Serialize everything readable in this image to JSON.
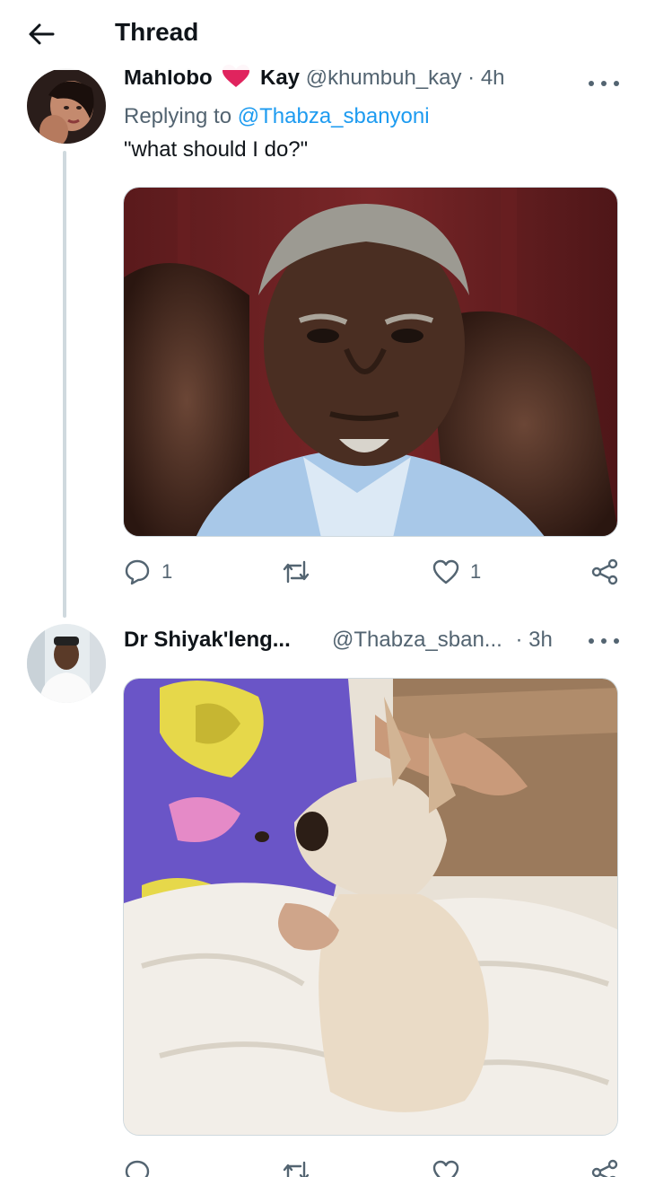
{
  "header": {
    "title": "Thread",
    "back_icon": "arrow-left-icon"
  },
  "tweets": [
    {
      "author_name_first": "Mahlobo",
      "author_name_last": "Kay",
      "handle": "@khumbuh_kay",
      "time": "· 4h",
      "replying_label": "Replying to",
      "replying_to": "@Thabza_sbanyoni",
      "text": "\"what should I do?\"",
      "reply_count": "1",
      "retweet_count": "",
      "like_count": "1"
    },
    {
      "author_name": "Dr Shiyak'leng...",
      "handle": "@Thabza_sban...",
      "time": "· 3h"
    }
  ],
  "colors": {
    "accent": "#1d9bf0",
    "muted": "#536471",
    "heart": "#e0245e",
    "line": "#cfd9de"
  }
}
